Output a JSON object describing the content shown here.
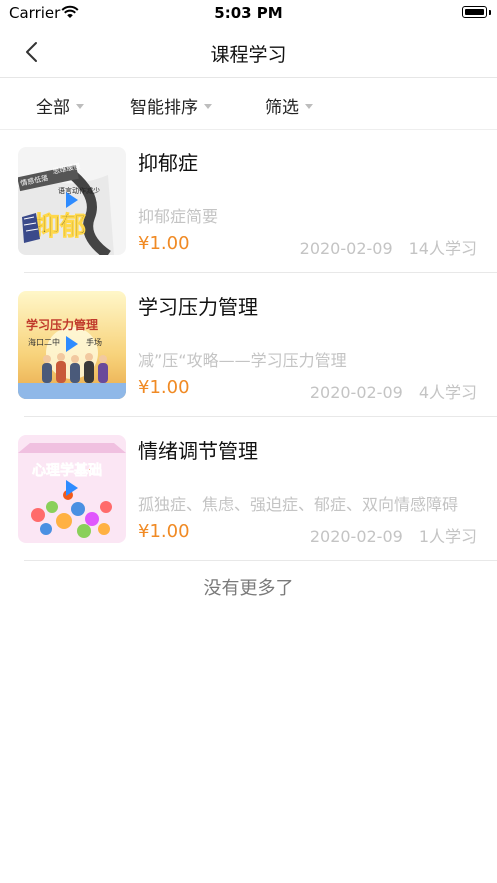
{
  "status_bar": {
    "carrier": "Carrier",
    "time": "5:03 PM"
  },
  "nav": {
    "title": "课程学习"
  },
  "filters": [
    {
      "label": "全部"
    },
    {
      "label": "智能排序"
    },
    {
      "label": "筛选"
    }
  ],
  "courses": [
    {
      "title": "抑郁症",
      "description": "抑郁症简要",
      "price": "¥1.00",
      "date": "2020-02-09",
      "learners": "14人学习",
      "thumb": {
        "texts": [
          "情感低落",
          "思维缓慢",
          "语言动作减少",
          "抑郁"
        ],
        "colors": [
          "#f4f4f4",
          "#444444",
          "#ffd84a"
        ]
      }
    },
    {
      "title": "学习压力管理",
      "description": "减”压“攻略——学习压力管理",
      "price": "¥1.00",
      "date": "2020-02-09",
      "learners": "4人学习",
      "thumb": {
        "texts": [
          "学习压力管理",
          "海口二中",
          "手场"
        ],
        "colors": [
          "#fff2b3",
          "#f2b84a",
          "#8fb8e8"
        ]
      }
    },
    {
      "title": "情绪调节管理",
      "description": "孤独症、焦虑、强迫症、郁症、双向情感障碍",
      "price": "¥1.00",
      "date": "2020-02-09",
      "learners": "1人学习",
      "thumb": {
        "texts": [
          "心理学基础"
        ],
        "colors": [
          "#fbe6f4",
          "#f25a1a",
          "#8ad05a"
        ]
      }
    }
  ],
  "footer": {
    "no_more": "没有更多了"
  },
  "colors": {
    "price": "#f08a24",
    "muted": "#c4c4c4",
    "play": "#2e8bff"
  }
}
